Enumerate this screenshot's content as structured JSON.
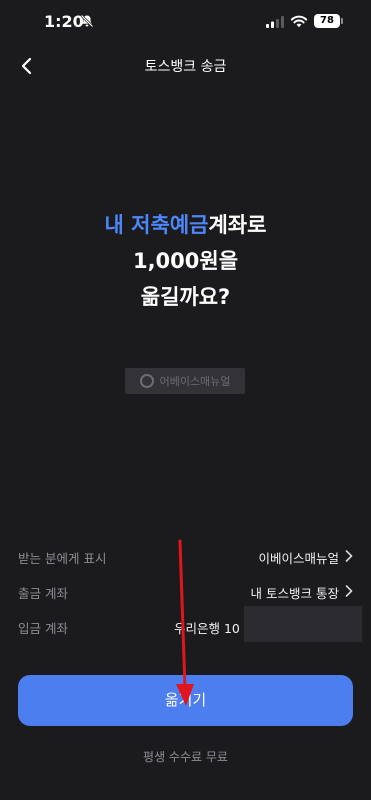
{
  "status_bar": {
    "time": "1:20",
    "battery": "78",
    "icons": [
      "bell-muted-icon",
      "signal-icon",
      "wifi-icon",
      "battery-icon"
    ]
  },
  "nav": {
    "title": "토스뱅크 송금",
    "back_icon": "chevron-left-icon"
  },
  "headline": {
    "account_highlight": "내 저축예금",
    "account_suffix": "계좌로",
    "amount_line": "1,000원을",
    "question_line": "옮길까요?"
  },
  "watermark": {
    "text": "어베이스매뉴얼"
  },
  "details": [
    {
      "label": "받는 분에게 표시",
      "value": "이베이스매뉴얼",
      "has_chevron": true
    },
    {
      "label": "출금 계좌",
      "value": "내 토스뱅크 통장",
      "has_chevron": true
    },
    {
      "label": "입금 계좌",
      "value": "우리은행 10",
      "has_chevron": false
    }
  ],
  "primary_button": {
    "label": "옮기기"
  },
  "footer": {
    "note": "평생 수수료 무료"
  },
  "colors": {
    "background": "#1b1b1e",
    "accent": "#4c86f7",
    "button": "#4c7ef0",
    "annotation_arrow": "#e0161e"
  }
}
